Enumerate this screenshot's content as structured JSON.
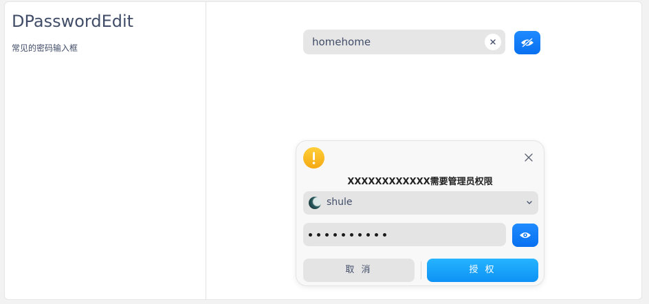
{
  "left_panel": {
    "title": "DPasswordEdit",
    "subtitle": "常见的密码输入框"
  },
  "password_field": {
    "value": "homehome",
    "clear_icon": "close-icon",
    "toggle_icon": "eye-slash-icon"
  },
  "auth_dialog": {
    "icon": "warning-icon",
    "close_icon": "close-icon",
    "title": "XXXXXXXXXXXX需要管理员权限",
    "user": {
      "name": "shule",
      "dropdown_icon": "chevron-down-icon"
    },
    "password_masked": "••••••••••",
    "toggle_icon": "eye-icon",
    "cancel_label": "取 消",
    "confirm_label": "授 权"
  },
  "colors": {
    "accent": "#0870f0",
    "confirm": "#1aa6ff",
    "warning": "#f5b41e"
  }
}
